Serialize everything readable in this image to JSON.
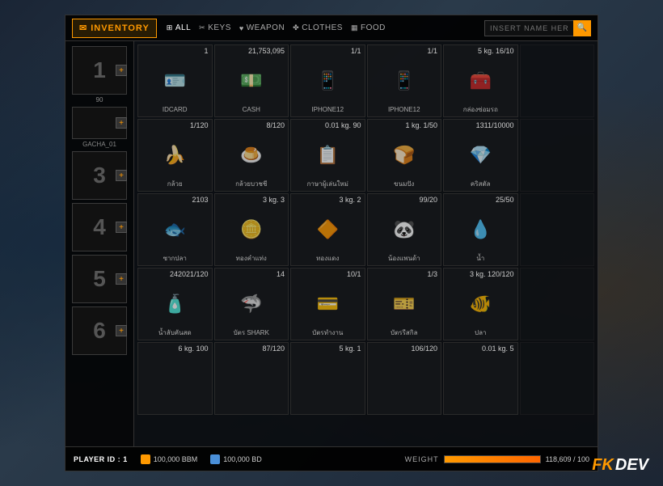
{
  "header": {
    "inventory_label": "INVENTORY",
    "tabs": [
      {
        "id": "all",
        "label": "ALL",
        "icon": "⊞",
        "active": true
      },
      {
        "id": "keys",
        "label": "KEYS",
        "icon": "🔑"
      },
      {
        "id": "weapon",
        "label": "WEAPON",
        "icon": "🔫"
      },
      {
        "id": "clothes",
        "label": "CLOTHES",
        "icon": "👕"
      },
      {
        "id": "food",
        "label": "FOOD",
        "icon": "🍔"
      }
    ],
    "search_placeholder": "INSERT NAME HERE"
  },
  "sidebar": {
    "slots": [
      {
        "num": "1",
        "label": "90",
        "sublabel": null
      },
      {
        "num": "",
        "label": "GACHA_01",
        "sublabel": null
      },
      {
        "num": "3",
        "label": null,
        "sublabel": null
      },
      {
        "num": "4",
        "label": null,
        "sublabel": null
      },
      {
        "num": "5",
        "label": null,
        "sublabel": null
      },
      {
        "num": "6",
        "label": null,
        "sublabel": null
      }
    ]
  },
  "items": [
    {
      "count": "1",
      "name": "IDCARD",
      "icon": "🪪",
      "empty": false
    },
    {
      "count": "21,753,095",
      "name": "CASH",
      "icon": "💵",
      "empty": false
    },
    {
      "count": "1/1",
      "name": "IPHONE12",
      "icon": "📱",
      "empty": false
    },
    {
      "count": "1/1",
      "name": "IPHONE12",
      "icon": "📱",
      "empty": false
    },
    {
      "count": "5 kg.",
      "name": "กล่องซ่อมรถ",
      "icon": "🧰",
      "count2": "16/10",
      "empty": false
    },
    {
      "count": "",
      "name": "",
      "icon": "",
      "empty": true
    },
    {
      "count": "1/120",
      "name": "กล้วย",
      "icon": "🍌",
      "empty": false
    },
    {
      "count": "8/120",
      "name": "กล้วยบวชชี",
      "icon": "🍮",
      "empty": false
    },
    {
      "count": "0.01 kg.",
      "name": "กาษาผู้เล่นใหม่",
      "icon": "📋",
      "count2": "90",
      "empty": false
    },
    {
      "count": "1 kg.",
      "name": "ขนมปัง",
      "icon": "🍞",
      "count2": "1/50",
      "empty": false
    },
    {
      "count": "1311/10000",
      "name": "คริสตัล",
      "icon": "💎",
      "empty": false
    },
    {
      "count": "",
      "name": "",
      "icon": "",
      "empty": true
    },
    {
      "count": "2103",
      "name": "ซากปลา",
      "icon": "🐟",
      "empty": false
    },
    {
      "count": "3 kg.",
      "name": "ทองคำแท่ง",
      "icon": "🪙",
      "count2": "3",
      "empty": false
    },
    {
      "count": "3 kg.",
      "name": "ทองแดง",
      "icon": "🔶",
      "count2": "2",
      "empty": false
    },
    {
      "count": "99/20",
      "name": "น้องแพนด้า",
      "icon": "🐼",
      "empty": false
    },
    {
      "count": "25/50",
      "name": "น้ำ",
      "icon": "💧",
      "empty": false
    },
    {
      "count": "",
      "name": "",
      "icon": "",
      "empty": true
    },
    {
      "count": "242021/120",
      "name": "น้ำลับคันสด",
      "icon": "🧴",
      "empty": false
    },
    {
      "count": "14",
      "name": "บัตร SHARK",
      "icon": "🦈",
      "empty": false
    },
    {
      "count": "10/1",
      "name": "บัตรทำงาน",
      "icon": "💳",
      "empty": false
    },
    {
      "count": "1/3",
      "name": "บัตรรีสกิล",
      "icon": "🎫",
      "empty": false
    },
    {
      "count": "3 kg.",
      "name": "ปลา",
      "icon": "🐠",
      "count2": "120/120",
      "empty": false
    },
    {
      "count": "",
      "name": "",
      "icon": "",
      "empty": true
    },
    {
      "count": "6 kg.",
      "name": "",
      "icon": "",
      "count2": "100",
      "empty": true
    },
    {
      "count": "87/120",
      "name": "",
      "icon": "",
      "empty": true
    },
    {
      "count": "5 kg.",
      "name": "",
      "icon": "",
      "count2": "1",
      "empty": true
    },
    {
      "count": "106/120",
      "name": "",
      "icon": "",
      "empty": true
    },
    {
      "count": "0.01 kg.",
      "name": "",
      "icon": "",
      "count2": "5",
      "empty": true
    },
    {
      "count": "",
      "name": "",
      "icon": "",
      "empty": true
    }
  ],
  "bottom": {
    "player_id_label": "PLAYER ID :",
    "player_id_value": "1",
    "bbm_label": "100,000 BBM",
    "bd_label": "100,000 BD",
    "weight_label": "WEIGHT",
    "weight_current": "118,609",
    "weight_max": "100",
    "weight_display": "118,609 / 100",
    "weight_pct": 100
  },
  "logo": {
    "fx": "F",
    "k": "K",
    "dev": "DEV"
  }
}
